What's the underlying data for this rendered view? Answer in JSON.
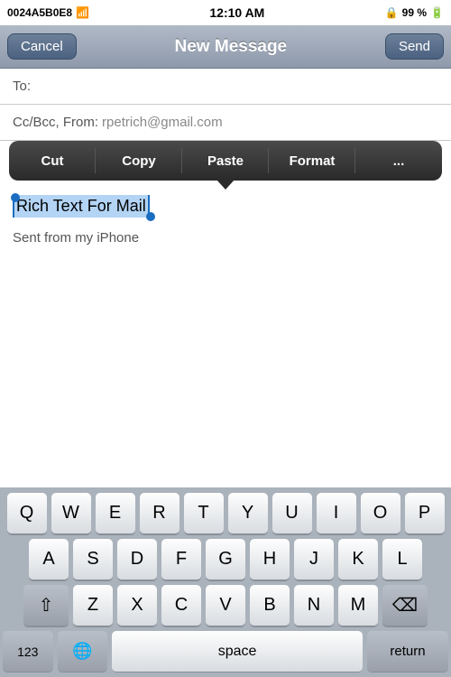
{
  "statusBar": {
    "carrier": "0024A5B0E8",
    "time": "12:10 AM",
    "battery": "99 %"
  },
  "navBar": {
    "cancelLabel": "Cancel",
    "title": "New Message",
    "sendLabel": "Send"
  },
  "emailForm": {
    "toLabel": "To:",
    "ccBccLabel": "Cc/Bcc, From:",
    "fromEmail": "rpetrich@gmail.com"
  },
  "contextMenu": {
    "cut": "Cut",
    "copy": "Copy",
    "paste": "Paste",
    "format": "Format",
    "more": "..."
  },
  "bodyText": {
    "selected": "Rich Text For Mail",
    "sentFrom": "Sent from my iPhone"
  },
  "keyboard": {
    "row1": [
      "Q",
      "W",
      "E",
      "R",
      "T",
      "Y",
      "U",
      "I",
      "O",
      "P"
    ],
    "row2": [
      "A",
      "S",
      "D",
      "F",
      "G",
      "H",
      "J",
      "K",
      "L"
    ],
    "row3": [
      "Z",
      "X",
      "C",
      "V",
      "B",
      "N",
      "M"
    ],
    "numberLabel": "123",
    "spaceLabel": "space",
    "returnLabel": "return"
  }
}
